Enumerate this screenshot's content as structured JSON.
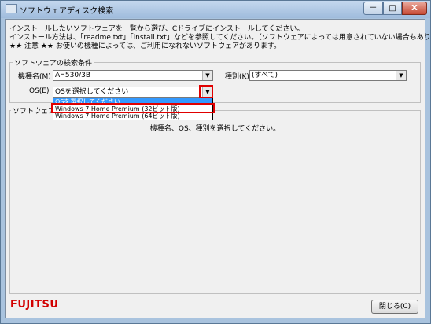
{
  "window": {
    "title": "ソフトウェアディスク検索",
    "minimize_label": "－",
    "maximize_label": "□",
    "close_label": "X"
  },
  "intro": {
    "line1": "インストールしたいソフトウェアを一覧から選び、Cドライブにインストールしてください。",
    "line2": "インストール方法は、「readme.txt」「install.txt」などを参照してください。（ソフトウェアによっては用意されていない場合もあります）",
    "line3": "★★ 注意 ★★ お使いの機種によっては、ご利用になれないソフトウェアがあります。"
  },
  "search": {
    "group_label": "ソフトウェアの検索条件",
    "model_label": "機種名(M)",
    "model_value": "AH530/3B",
    "type_label": "種別(K)",
    "type_value": "(すべて)",
    "os_label": "OS(E)",
    "os_value": "OSを選択してください",
    "os_options": [
      "OSを選択してください",
      "Windows 7 Home Premium (32ビット版)",
      "Windows 7 Home Premium (64ビット版)"
    ],
    "dropdown_arrow": "▼"
  },
  "software": {
    "group_label": "ソフトウェア",
    "message": "機種名、OS、種別を選択してください。"
  },
  "footer": {
    "logo_text": "FUJITSU",
    "close_button": "閉じる(C)"
  }
}
